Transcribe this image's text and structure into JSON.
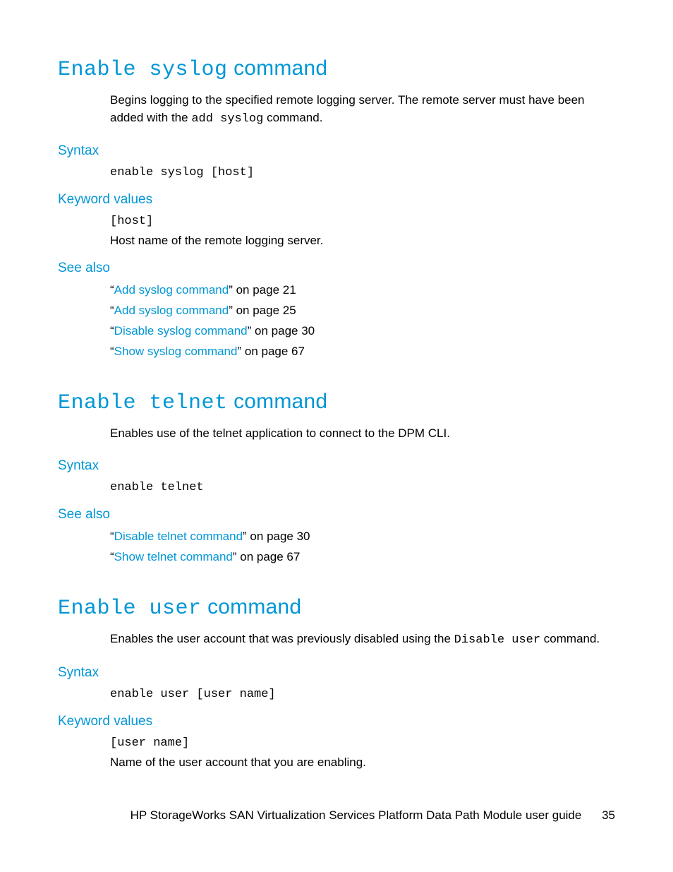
{
  "sections": [
    {
      "title_mono": "Enable syslog",
      "title_suffix": " command",
      "desc_pre": "Begins logging to the specified remote logging server. The remote server must have been added with the ",
      "desc_mono": "add syslog",
      "desc_post": " command.",
      "syntax_h": "Syntax",
      "syntax_code": "enable syslog [host]",
      "kw_h": "Keyword values",
      "kw_code": "[host]",
      "kw_desc": "Host name of the remote logging server.",
      "see_h": "See also",
      "see": [
        {
          "q1": "“",
          "link": "Add syslog command",
          "q2": "” on page 21"
        },
        {
          "q1": "“",
          "link": "Add syslog command",
          "q2": "” on page 25"
        },
        {
          "q1": "“",
          "link": "Disable syslog command",
          "q2": "” on page 30"
        },
        {
          "q1": "“",
          "link": "Show syslog command",
          "q2": "” on page 67"
        }
      ]
    },
    {
      "title_mono": "Enable telnet",
      "title_suffix": " command",
      "desc_plain": "Enables use of the telnet application to connect to the DPM CLI.",
      "syntax_h": "Syntax",
      "syntax_code": "enable telnet",
      "see_h": "See also",
      "see": [
        {
          "q1": "“",
          "link": "Disable telnet command",
          "q2": "” on page 30"
        },
        {
          "q1": "“",
          "link": "Show telnet command",
          "q2": "” on page 67"
        }
      ]
    },
    {
      "title_mono": "Enable user",
      "title_suffix": " command",
      "desc_pre": "Enables the user account that was previously disabled using the ",
      "desc_mono": "Disable user",
      "desc_post": " command.",
      "syntax_h": "Syntax",
      "syntax_code": "enable user [user name]",
      "kw_h": "Keyword values",
      "kw_code": "[user name]",
      "kw_desc": "Name of the user account that you are enabling."
    }
  ],
  "footer": {
    "text": "HP StorageWorks SAN Virtualization Services Platform Data Path Module user guide",
    "page": "35"
  }
}
